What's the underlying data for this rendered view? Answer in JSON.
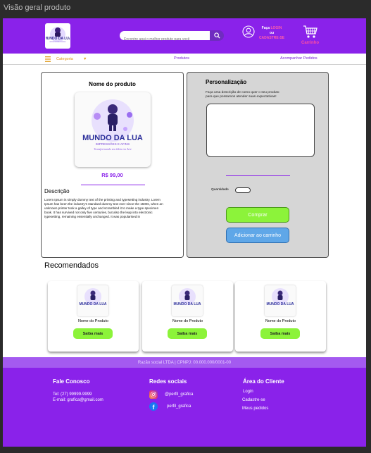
{
  "window": {
    "title": "Visão geral produto"
  },
  "header": {
    "logo": {
      "line1": "MUNDO DA LUA",
      "line2": "IMPRESSÕES E AFINS",
      "tagline": "Transformando seu Ideia em Arte"
    },
    "search_placeholder": "Encontre aqui o melhor produto para você",
    "login": {
      "part1": "Faça",
      "part2": "LOGIN",
      "part3": "ou",
      "part4": "CADASTRE-SE"
    },
    "cart_label": "Carrinho"
  },
  "nav": {
    "category": "Categoria",
    "products": "Produtos",
    "orders": "Acompanhar Pedidos"
  },
  "product": {
    "name": "Nome do produto",
    "price": "R$ 99,00",
    "desc_title": "Descrição",
    "description": "Lorem Ipsum is simply dummy text of the printing and typesetting industry. Lorem Ipsum has been the industry's standard dummy text ever since the 1500s, when an unknown printer took a galley of type and scrambled it to make a type specimen book. It has survived not only five centuries, but also the leap into electronic typesetting, remaining essentially unchanged. It was popularised in"
  },
  "personalization": {
    "title": "Personalização",
    "subtitle": "Faça uma descrição de como quer o seu produto para que possamos atender suas expectativas!",
    "qty_label": "Quantidade",
    "buy_label": "Comprar",
    "add_label": "Adicionar ao carrinho"
  },
  "recommended": {
    "title": "Recomendados",
    "items": [
      {
        "name": "Nome do Produto",
        "button": "Saiba mais"
      },
      {
        "name": "Nome do Produto",
        "button": "Saiba mais"
      },
      {
        "name": "Nome do Produto",
        "button": "Saiba mais"
      }
    ]
  },
  "footer": {
    "company": "Razão social LTDA | CPNPJ: 00.000.000/0001-00",
    "contact": {
      "title": "Fale Conosco",
      "phone": "Tel: (27) 99999-9999",
      "email": "E-mail: grafica@gmail.com"
    },
    "social": {
      "title": "Redes sociais",
      "instagram": "@perfil_grafica",
      "facebook": "perfil_grafica"
    },
    "client": {
      "title": "Área do Cliente",
      "login": "Login",
      "signup": "Cadastre-se",
      "orders": "Meus  pedidos"
    }
  },
  "colors": {
    "purple": "#8a22ea",
    "green": "#8cf33a",
    "blue": "#5fa7e8",
    "pink": "#ff4fa0",
    "orange": "#e09a1a"
  },
  "icons": [
    "search-icon",
    "user-icon",
    "cart-icon",
    "menu-icon",
    "caret-down-icon",
    "instagram-icon",
    "facebook-icon"
  ]
}
